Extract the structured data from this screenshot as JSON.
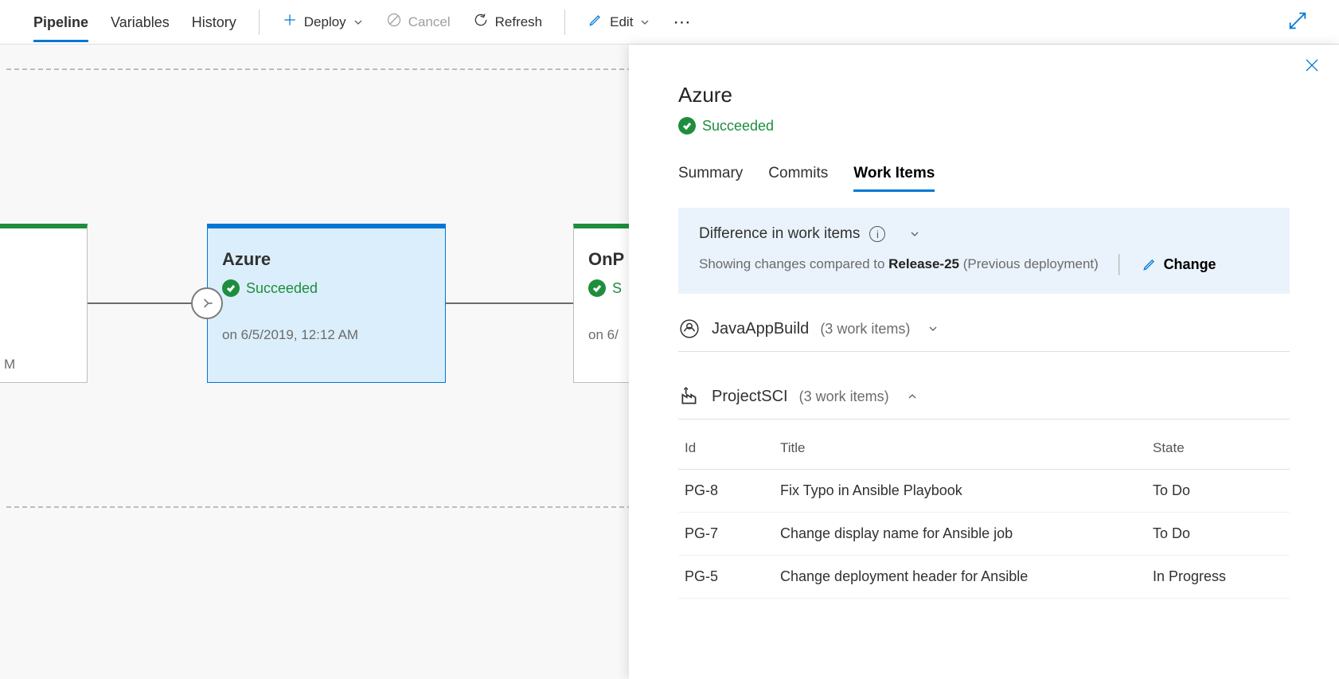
{
  "toolbar": {
    "tabs": [
      "Pipeline",
      "Variables",
      "History"
    ],
    "deploy": "Deploy",
    "cancel": "Cancel",
    "refresh": "Refresh",
    "edit": "Edit"
  },
  "canvas": {
    "partial_left_text": "M",
    "stage_azure": {
      "title": "Azure",
      "status": "Succeeded",
      "date": "on 6/5/2019, 12:12 AM"
    },
    "stage_onprem": {
      "title": "OnP",
      "status": "S",
      "date": "on 6/"
    }
  },
  "panel": {
    "title": "Azure",
    "status": "Succeeded",
    "tabs": [
      "Summary",
      "Commits",
      "Work Items"
    ],
    "diff": {
      "heading": "Difference in work items",
      "compare_prefix": "Showing changes compared to ",
      "compare_release": "Release-25",
      "compare_suffix": " (Previous deployment)",
      "change": "Change"
    },
    "groups": [
      {
        "name": "JavaAppBuild",
        "count": "(3 work items)",
        "expanded": false
      },
      {
        "name": "ProjectSCI",
        "count": "(3 work items)",
        "expanded": true
      }
    ],
    "table": {
      "headers": {
        "id": "Id",
        "title": "Title",
        "state": "State"
      },
      "rows": [
        {
          "id": "PG-8",
          "title": "Fix Typo in Ansible Playbook",
          "state": "To Do"
        },
        {
          "id": "PG-7",
          "title": "Change display name for Ansible job",
          "state": "To Do"
        },
        {
          "id": "PG-5",
          "title": "Change deployment header for Ansible",
          "state": "In Progress"
        }
      ]
    }
  }
}
